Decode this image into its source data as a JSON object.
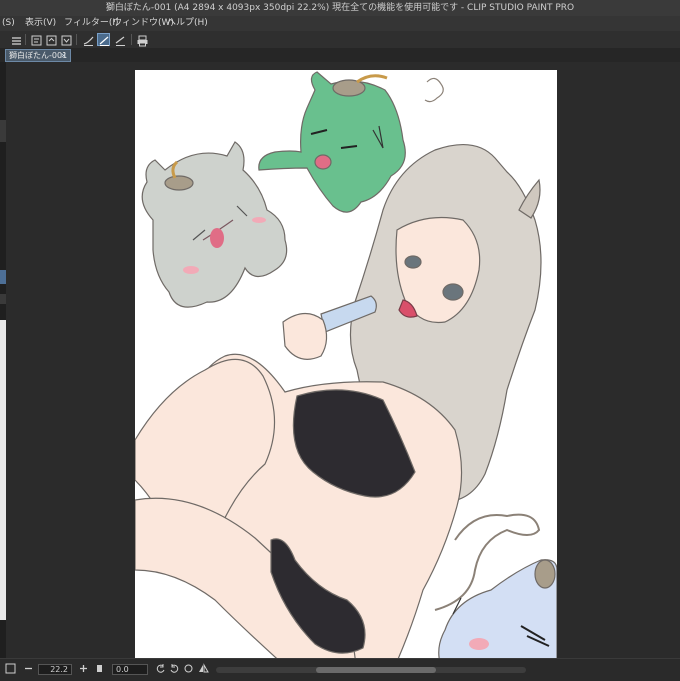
{
  "window": {
    "title": "獅白ぼたん-001 (A4 2894 x 4093px 350dpi 22.2%)  現在全ての機能を使用可能です - CLIP STUDIO PAINT PRO"
  },
  "menu": {
    "items": [
      "(S)",
      "表示(V)",
      "フィルター(I)",
      "ウィンドウ(W)",
      "ヘルプ(H)"
    ]
  },
  "tabs": {
    "document": "獅白ぼたん-001",
    "close_glyph": "×"
  },
  "toolbar": {
    "icons": [
      "menu-icon",
      "new-file-icon",
      "open-file-icon",
      "save-file-icon",
      "pen-stroke-icon",
      "selected-stroke-icon",
      "line-tool-icon",
      "print-icon"
    ],
    "active": "selected-stroke-icon"
  },
  "status": {
    "zoom": "22.2",
    "angle": "0.0"
  },
  "colors": {
    "accent": "#7aa0c8",
    "paper": "#ffffff",
    "workspace": "#2b2b2b"
  }
}
